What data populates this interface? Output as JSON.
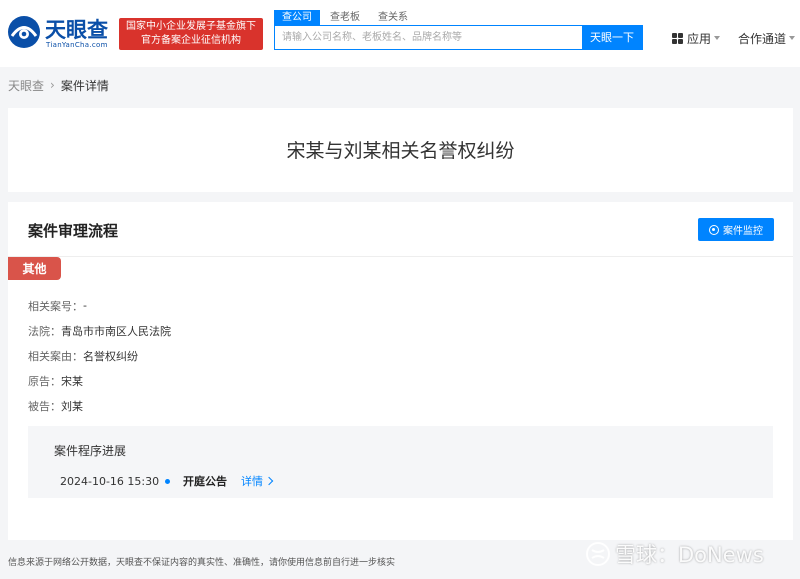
{
  "header": {
    "logo": {
      "name_cn": "天眼查",
      "name_en": "TianYanCha.com"
    },
    "banner": {
      "line1": "国家中小企业发展子基金旗下",
      "line2": "官方备案企业征信机构"
    },
    "search": {
      "tabs": [
        {
          "label": "查公司",
          "active": true
        },
        {
          "label": "查老板",
          "active": false
        },
        {
          "label": "查关系",
          "active": false
        }
      ],
      "placeholder": "请输入公司名称、老板姓名、品牌名称等",
      "button_label": "天眼一下"
    },
    "nav": {
      "apps_label": "应用",
      "coop_label": "合作通道"
    }
  },
  "breadcrumb": {
    "home": "天眼查",
    "current": "案件详情"
  },
  "case": {
    "title": "宋某与刘某相关名誉权纠纷"
  },
  "process": {
    "section_title": "案件审理流程",
    "monitor_label": "案件监控",
    "tag": "其他",
    "fields": [
      {
        "label": "相关案号：",
        "value": "-"
      },
      {
        "label": "法院：",
        "value": "青岛市市南区人民法院"
      },
      {
        "label": "相关案由：",
        "value": "名誉权纠纷"
      },
      {
        "label": "原告：",
        "value": "宋某"
      },
      {
        "label": "被告：",
        "value": "刘某"
      }
    ],
    "progress": {
      "title": "案件程序进展",
      "items": [
        {
          "date": "2024-10-16 15:30",
          "event": "开庭公告",
          "link": "详情"
        }
      ]
    }
  },
  "footer": {
    "disclaimer": "信息来源于网络公开数据，天眼查不保证内容的真实性、准确性，请你使用信息前自行进一步核实",
    "watermark": "雪球：DoNews"
  },
  "colors": {
    "primary": "#0084ff",
    "brand_red": "#d9332c",
    "tag_red": "#d9544a",
    "logo_blue": "#0a4fa8"
  }
}
